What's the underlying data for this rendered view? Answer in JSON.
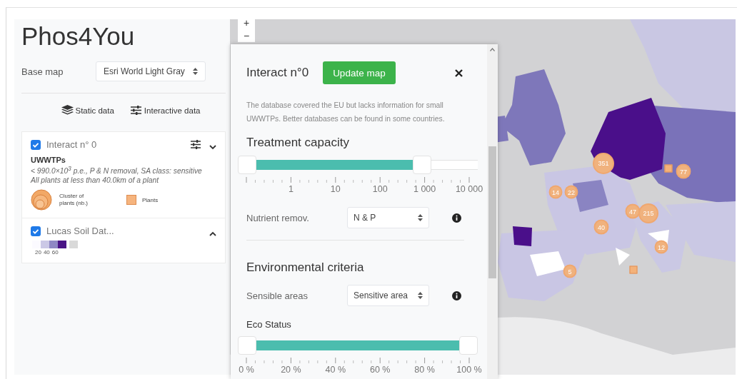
{
  "sidebar": {
    "title": "Phos4You",
    "base_map": {
      "label": "Base map",
      "value": "Esri World Light Gray"
    },
    "tabs": [
      {
        "kind": "static",
        "label": "Static data"
      },
      {
        "kind": "interactive",
        "label": "Interactive data"
      }
    ],
    "layers": [
      {
        "kind": "interact",
        "title": "Interact n° 0",
        "checked": true,
        "expanded": false,
        "heading": "UWWTPs",
        "lines": [
          "< 990.0×10$^{3}$ p.e., P & N removal, SA class: sensitive",
          "All plants at less than 40.0km of a plant"
        ],
        "legend": [
          {
            "kind": "cluster",
            "label": "Cluster of plants (nb.)"
          },
          {
            "kind": "plant",
            "label": "Plants"
          }
        ]
      },
      {
        "kind": "soil",
        "title": "Lucas Soil Dat...",
        "checked": true,
        "expanded": true,
        "swatches": [
          {
            "color": "#fbfaff"
          },
          {
            "color": "#cbc8e6"
          },
          {
            "color": "#8f88c4"
          },
          {
            "color": "#4a1486"
          },
          {
            "color": "#d9d9d9"
          }
        ],
        "scale_labels": [
          "20",
          "40",
          "60"
        ]
      }
    ]
  },
  "map": {
    "zoom": [
      "+",
      "−"
    ],
    "markers": [
      {
        "kind": "cluster",
        "label": "351"
      },
      {
        "kind": "cluster",
        "label": "14"
      },
      {
        "kind": "cluster",
        "label": "22"
      },
      {
        "kind": "cluster",
        "label": "77"
      },
      {
        "kind": "cluster",
        "label": "47"
      },
      {
        "kind": "cluster",
        "label": "215"
      },
      {
        "kind": "cluster",
        "label": "40"
      },
      {
        "kind": "cluster",
        "label": "12"
      },
      {
        "kind": "cluster",
        "label": "5"
      },
      {
        "kind": "plant"
      },
      {
        "kind": "plant"
      }
    ]
  },
  "panel": {
    "title": "Interact n°0",
    "button": "Update map",
    "note": "The database covered the EU but lacks information for small UWWTPs. Better databases can be found in some countries.",
    "items": [
      {
        "kind": "heading",
        "text": "Treatment capacity"
      },
      {
        "kind": "slider",
        "level": 0.79,
        "ticks": [
          "1",
          "10",
          "100",
          "1 000",
          "10 000"
        ]
      },
      {
        "kind": "select",
        "label": "Nutrient remov.",
        "value": "N & P"
      },
      {
        "kind": "divider"
      },
      {
        "kind": "heading",
        "text": "Environmental criteria"
      },
      {
        "kind": "select",
        "label": "Sensible areas",
        "value": "Sensitive area"
      },
      {
        "kind": "subheading",
        "text": "Eco Status"
      },
      {
        "kind": "slider",
        "level": 1,
        "ticks": [
          "0 %",
          "20 %",
          "40 %",
          "60 %",
          "80 %",
          "100 %"
        ]
      }
    ]
  }
}
